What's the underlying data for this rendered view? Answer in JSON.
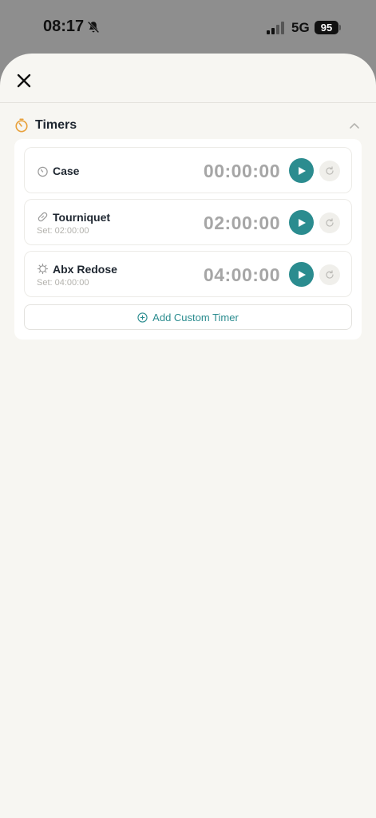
{
  "status_bar": {
    "time": "08:17",
    "network": "5G",
    "battery": "95"
  },
  "section": {
    "title": "Timers"
  },
  "timers": [
    {
      "name": "Case",
      "set": "",
      "value": "00:00:00"
    },
    {
      "name": "Tourniquet",
      "set": "Set: 02:00:00",
      "value": "02:00:00"
    },
    {
      "name": "Abx Redose",
      "set": "Set: 04:00:00",
      "value": "04:00:00"
    }
  ],
  "add_button": {
    "label": "Add Custom Timer"
  },
  "colors": {
    "accent": "#2b8c8f",
    "section_icon": "#e8a13c",
    "sheet_bg": "#f7f6f2"
  }
}
